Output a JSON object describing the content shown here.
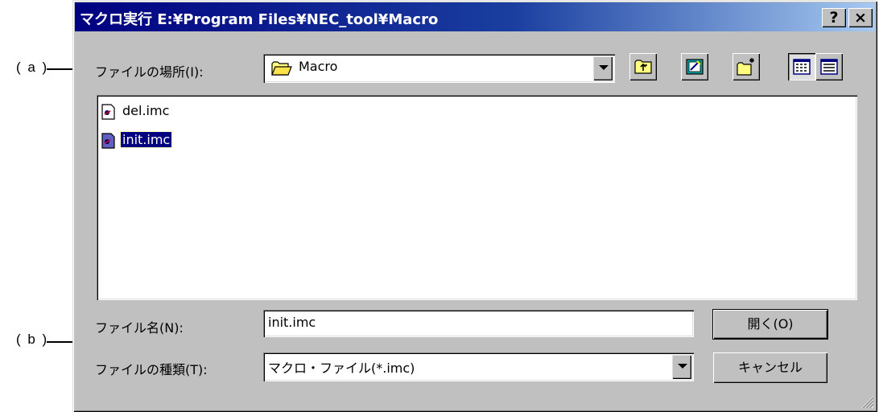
{
  "annotations": {
    "a": "( a )",
    "b": "( b )"
  },
  "dialog": {
    "title": "マクロ実行  E:¥Program Files¥NEC_tool¥Macro",
    "help_label": "?",
    "close_label": "×",
    "location_label": "ファイルの場所(I):",
    "location_value": "Macro",
    "files": [
      {
        "name": "del.imc",
        "selected": false
      },
      {
        "name": "init.imc",
        "selected": true
      }
    ],
    "filename_label": "ファイル名(N):",
    "filename_value": "init.imc",
    "filetype_label": "ファイルの種類(T):",
    "filetype_value": "マクロ・ファイル(*.imc)",
    "open_label": "開く(O)",
    "cancel_label": "キャンセル"
  },
  "colors": {
    "titlebar": "#000080",
    "face": "#c0c0c0",
    "selection": "#000080"
  },
  "icons": [
    "up-folder-icon",
    "desktop-icon",
    "new-folder-icon",
    "list-view-icon",
    "details-view-icon",
    "folder-icon",
    "macro-file-icon",
    "resize-grip-icon"
  ]
}
